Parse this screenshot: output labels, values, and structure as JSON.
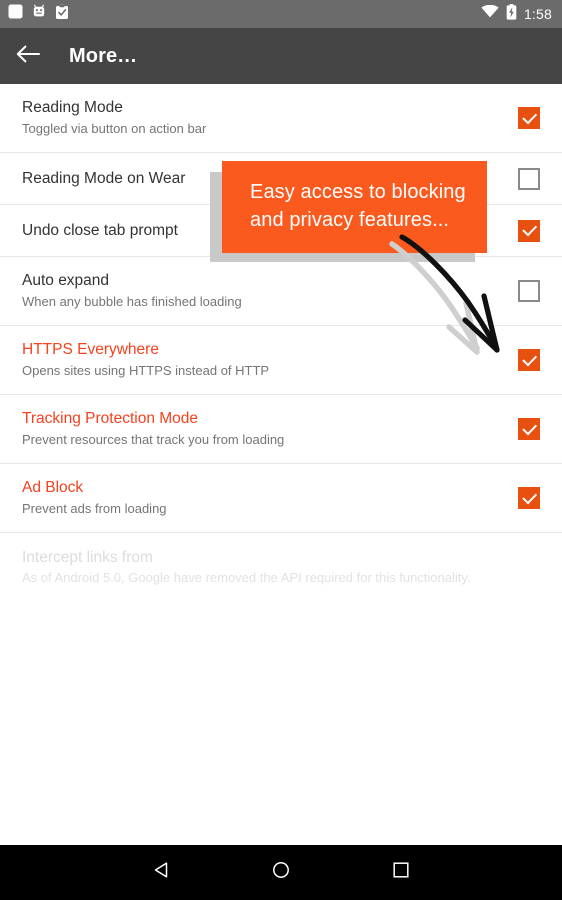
{
  "status_bar": {
    "icons": [
      "blank-square-icon",
      "android-robot-icon",
      "clipboard-check-icon"
    ],
    "right_icons": [
      "wifi-icon",
      "battery-charging-icon"
    ],
    "clock": "1:58",
    "background": "#6b6b6b"
  },
  "toolbar": {
    "back_icon": "back-arrow-icon",
    "title": "More…",
    "background": "#454545"
  },
  "colors": {
    "accent": "#f4421e",
    "checkbox_checked": "#e8500f",
    "callout_orange": "#fa5a1e",
    "callout_shadow": "#c9c9c9",
    "divider": "#e8e8e8",
    "muted_text": "#dcdcdc"
  },
  "settings": {
    "rows": [
      {
        "title": "Reading Mode",
        "subtitle": "Toggled via button on action bar",
        "accent": false,
        "checked": true,
        "disabled": false
      },
      {
        "title": "Reading Mode on Wear",
        "subtitle": "",
        "accent": false,
        "checked": false,
        "disabled": false
      },
      {
        "title": "Undo close tab prompt",
        "subtitle": "",
        "accent": false,
        "checked": true,
        "disabled": false
      },
      {
        "title": "Auto expand",
        "subtitle": "When any bubble has finished loading",
        "accent": false,
        "checked": false,
        "disabled": false
      },
      {
        "title": "HTTPS Everywhere",
        "subtitle": "Opens sites using HTTPS instead of HTTP",
        "accent": true,
        "checked": true,
        "disabled": false
      },
      {
        "title": "Tracking Protection Mode",
        "subtitle": "Prevent resources that track you from loading",
        "accent": true,
        "checked": true,
        "disabled": false
      },
      {
        "title": "Ad Block",
        "subtitle": "Prevent ads from loading",
        "accent": true,
        "checked": true,
        "disabled": false
      },
      {
        "title": "Intercept links from",
        "subtitle": "As of Android 5.0, Google have removed the API required for this functionality.",
        "accent": false,
        "checked": null,
        "disabled": true
      }
    ]
  },
  "callout": {
    "text": "Easy access to blocking\nand privacy features...",
    "arrow_icon": "hand-drawn-arrow-icon"
  },
  "nav_bar": {
    "back_label": "back-triangle-icon",
    "home_label": "home-circle-icon",
    "recents_label": "recents-square-icon"
  }
}
